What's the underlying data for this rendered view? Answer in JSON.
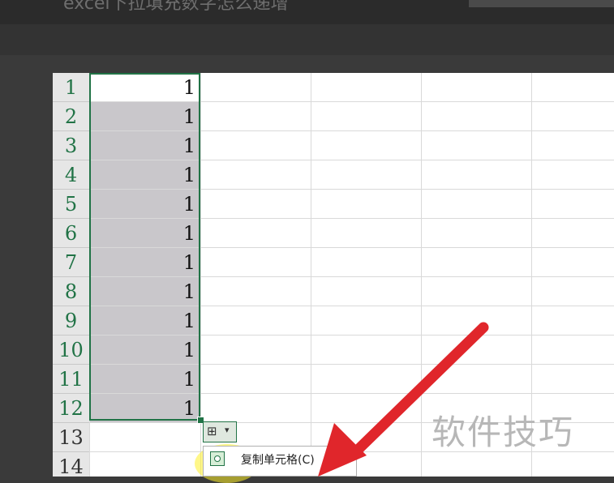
{
  "window": {
    "title_left": "",
    "title": "excel下拉填充数字怎么递增"
  },
  "sheet": {
    "row_headers": [
      "1",
      "2",
      "3",
      "4",
      "5",
      "6",
      "7",
      "8",
      "9",
      "10",
      "11",
      "12",
      "13",
      "14"
    ],
    "column_a_values": [
      "1",
      "1",
      "1",
      "1",
      "1",
      "1",
      "1",
      "1",
      "1",
      "1",
      "1",
      "1",
      "",
      ""
    ],
    "selected_rows": 12
  },
  "autofill": {
    "button_icon": "autofill-options-icon",
    "caret_icon": "chevron-down-icon",
    "menu_items": [
      {
        "label": "复制单元格(C)",
        "icon": "radio-selected-icon"
      }
    ]
  },
  "watermark": "软件技巧",
  "colors": {
    "accent": "#217346",
    "selection_fill": "#c9c7cb",
    "arrow": "#e0262b",
    "highlight": "#fff028"
  }
}
